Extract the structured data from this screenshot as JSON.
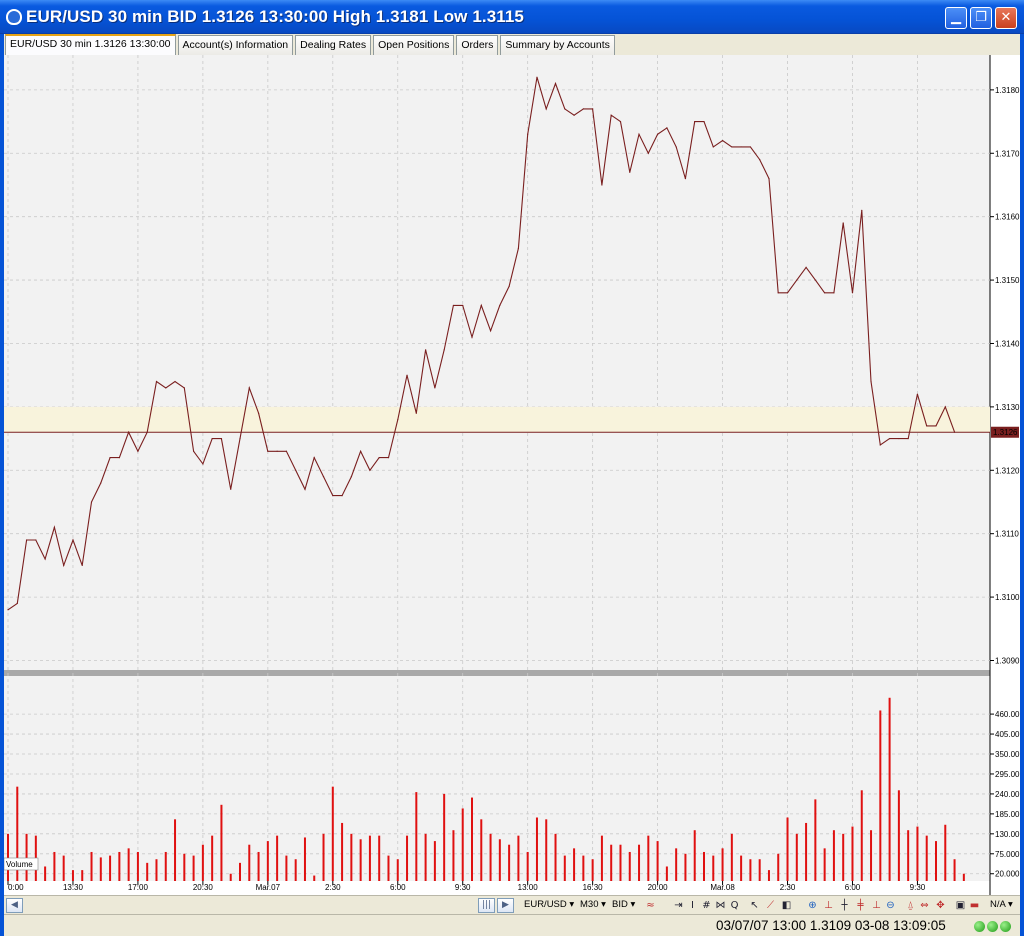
{
  "window": {
    "title": "EUR/USD 30 min BID 1.3126 13:30:00 High 1.3181 Low 1.3115",
    "minimize_glyph": "▁",
    "maximize_glyph": "❐",
    "close_glyph": "✕"
  },
  "tabs": [
    {
      "label": "EUR/USD 30 min 1.3126 13:30:00",
      "active": true
    },
    {
      "label": "Account(s) Information",
      "active": false
    },
    {
      "label": "Dealing Rates",
      "active": false
    },
    {
      "label": "Open Positions",
      "active": false
    },
    {
      "label": "Orders",
      "active": false
    },
    {
      "label": "Summary by Accounts",
      "active": false
    }
  ],
  "chart_data": [
    {
      "type": "line",
      "series": [
        {
          "values": [
            1.3098,
            1.3099,
            1.3109,
            1.3109,
            1.3106,
            1.3111,
            1.3105,
            1.3109,
            1.3105,
            1.3115,
            1.3118,
            1.3122,
            1.3122,
            1.3126,
            1.3123,
            1.3126,
            1.3134,
            1.3133,
            1.3134,
            1.3133,
            1.3123,
            1.3121,
            1.3125,
            1.3125,
            1.3117,
            1.3125,
            1.3133,
            1.3129,
            1.3123,
            1.3123,
            1.3123,
            1.312,
            1.3117,
            1.3122,
            1.3119,
            1.3116,
            1.3116,
            1.3119,
            1.3123,
            1.312,
            1.3122,
            1.3122,
            1.3128,
            1.3135,
            1.3129,
            1.3139,
            1.3133,
            1.3139,
            1.3146,
            1.3146,
            1.3141,
            1.3146,
            1.3142,
            1.3146,
            1.3149,
            1.3155,
            1.3173,
            1.3182,
            1.3177,
            1.3181,
            1.3177,
            1.3176,
            1.3177,
            1.3177,
            1.3165,
            1.3176,
            1.3175,
            1.3167,
            1.3173,
            1.317,
            1.3173,
            1.3174,
            1.3171,
            1.3166,
            1.3175,
            1.3175,
            1.3171,
            1.3172,
            1.3171,
            1.3171,
            1.3171,
            1.3169,
            1.3166,
            1.3148,
            1.3148,
            1.315,
            1.3152,
            1.315,
            1.3148,
            1.3148,
            1.3159,
            1.3148,
            1.3161,
            1.3134,
            1.3124,
            1.3125,
            1.3125,
            1.3125,
            1.3132,
            1.3127,
            1.3127,
            1.313,
            1.3126
          ]
        }
      ],
      "y_ticks": [
        "1.3180",
        "1.3170",
        "1.3160",
        "1.3150",
        "1.3140",
        "1.3130",
        "1.3120",
        "1.3110",
        "1.3100",
        "1.3090"
      ],
      "ylim": [
        1.30885,
        1.31855
      ],
      "current_price_label": "1.3126",
      "current_price": 1.3126,
      "highlight_band": [
        1.3126,
        1.313
      ],
      "grid": true
    },
    {
      "type": "bar",
      "label": "Volume",
      "values": [
        130,
        260,
        130,
        125,
        40,
        80,
        70,
        30,
        30,
        80,
        65,
        70,
        80,
        90,
        80,
        50,
        60,
        80,
        170,
        75,
        70,
        100,
        125,
        210,
        20,
        50,
        100,
        80,
        110,
        125,
        70,
        60,
        120,
        15,
        130,
        260,
        160,
        130,
        115,
        125,
        125,
        70,
        60,
        125,
        245,
        130,
        110,
        240,
        140,
        200,
        230,
        170,
        130,
        115,
        100,
        125,
        80,
        175,
        170,
        130,
        70,
        90,
        70,
        60,
        125,
        100,
        100,
        80,
        100,
        125,
        110,
        40,
        90,
        75,
        140,
        80,
        70,
        90,
        130,
        70,
        60,
        60,
        30,
        75,
        175,
        130,
        160,
        225,
        90,
        140,
        130,
        150,
        250,
        140,
        470,
        505,
        250,
        140,
        150,
        125,
        110,
        155,
        60,
        20
      ],
      "y_ticks": [
        "460.00",
        "405.00",
        "350.00",
        "295.00",
        "240.00",
        "185.00",
        "130.00",
        "75.000",
        "20.000"
      ],
      "ylim": [
        0,
        565
      ]
    }
  ],
  "time_axis": [
    "0:00",
    "13:30",
    "17:00",
    "20:30",
    "Mar.07",
    "2:30",
    "6:00",
    "9:30",
    "13:00",
    "16:30",
    "20:00",
    "Mar.08",
    "2:30",
    "6:00",
    "9:30"
  ],
  "toolbar": {
    "instrument": "EUR/USD ▾",
    "timeframe": "M30 ▾",
    "price_type": "BID ▾",
    "na_label": "N/A ▾"
  },
  "status": {
    "text": "03/07/07 13:00   1.3109  03-08 13:09:05"
  },
  "colors": {
    "title_bar": "#0553d6",
    "price_line": "#7a1f1f",
    "volume_bar": "#e01010",
    "chart_bg": "#f2f2f2",
    "band": "#f8f3dc"
  }
}
